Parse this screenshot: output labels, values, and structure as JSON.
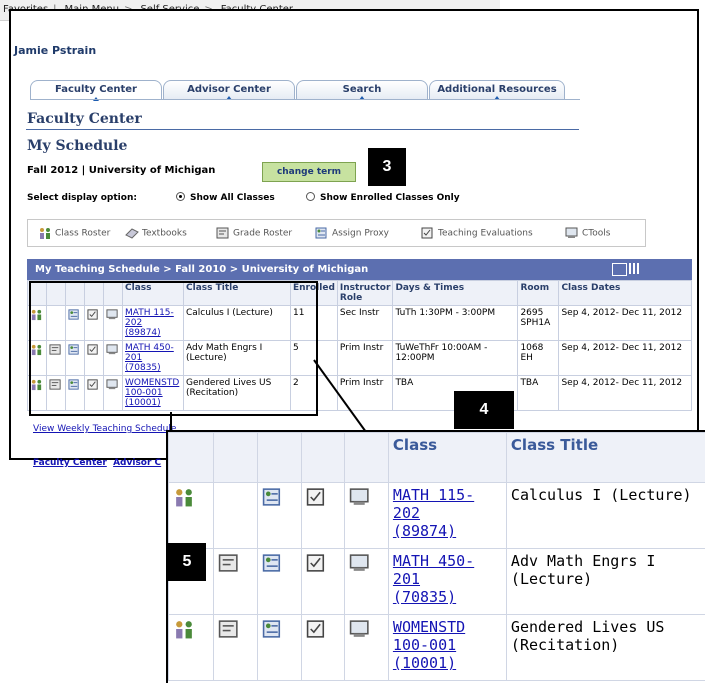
{
  "breadcrumb": [
    "Favorites",
    "Main Menu",
    "Self Service",
    "Faculty Center"
  ],
  "breadcrumb_separators": [
    "|",
    ">",
    ">"
  ],
  "user_name": "Jamie Pstrain",
  "tabs": [
    "Faculty Center",
    "Advisor Center",
    "Search",
    "Additional Resources"
  ],
  "active_tab": "Faculty Center",
  "page_title": "Faculty Center",
  "section_title": "My Schedule",
  "term": "Fall 2012 | University of Michigan",
  "change_term_label": "change term",
  "display_option_label": "Select display option:",
  "display_options": [
    "Show All Classes",
    "Show Enrolled Classes Only"
  ],
  "selected_display_option": "Show All Classes",
  "legend": [
    {
      "label": "Class Roster",
      "icon": "class-roster-icon"
    },
    {
      "label": "Textbooks",
      "icon": "textbooks-icon"
    },
    {
      "label": "Grade Roster",
      "icon": "grade-roster-icon"
    },
    {
      "label": "Assign Proxy",
      "icon": "assign-proxy-icon"
    },
    {
      "label": "Teaching Evaluations",
      "icon": "teaching-evaluations-icon"
    },
    {
      "label": "CTools",
      "icon": "ctools-icon"
    }
  ],
  "schedule_header": "My Teaching Schedule > Fall 2010 > University of Michigan",
  "columns": [
    "Class",
    "Class Title",
    "Enrolled",
    "Instructor Role",
    "Days & Times",
    "Room",
    "Class Dates"
  ],
  "rows": [
    {
      "class_lines": [
        "MATH 115-",
        "202",
        "(89874)"
      ],
      "title": "Calculus I (Lecture)",
      "enrolled": "11",
      "role": "Sec Instr",
      "days_times": "TuTh 1:30PM - 3:00PM",
      "room": "2695 SPH1A",
      "dates": "Sep 4, 2012- Dec 11, 2012",
      "icons": [
        "class-roster-icon",
        "",
        "assign-proxy-icon",
        "teaching-evaluations-icon",
        "ctools-icon"
      ]
    },
    {
      "class_lines": [
        "MATH 450-",
        "201",
        "(70835)"
      ],
      "title": "Adv Math Engrs I (Lecture)",
      "enrolled": "5",
      "role": "Prim Instr",
      "days_times": "TuWeThFr 10:00AM - 12:00PM",
      "room": "1068 EH",
      "dates": "Sep 4, 2012- Dec 11, 2012",
      "icons": [
        "class-roster-icon",
        "grade-roster-icon",
        "assign-proxy-icon",
        "teaching-evaluations-icon",
        "ctools-icon"
      ]
    },
    {
      "class_lines": [
        "WOMENSTD",
        "100-001",
        "(10001)"
      ],
      "title": "Gendered Lives US (Recitation)",
      "enrolled": "2",
      "role": "Prim Instr",
      "days_times": "TBA",
      "room": "TBA",
      "dates": "Sep 4, 2012- Dec 11, 2012",
      "icons": [
        "class-roster-icon",
        "grade-roster-icon",
        "assign-proxy-icon",
        "teaching-evaluations-icon",
        "ctools-icon"
      ]
    }
  ],
  "view_weekly_link": "View Weekly Teaching Schedule",
  "bottom_links": [
    "Faculty Center",
    "Advisor C"
  ],
  "callouts": [
    "3",
    "4",
    "5"
  ],
  "colors": {
    "accent": "#5c6fb0",
    "heading": "#2a3f6a",
    "link": "#1414b4",
    "button_green": "#c7e2a0"
  }
}
